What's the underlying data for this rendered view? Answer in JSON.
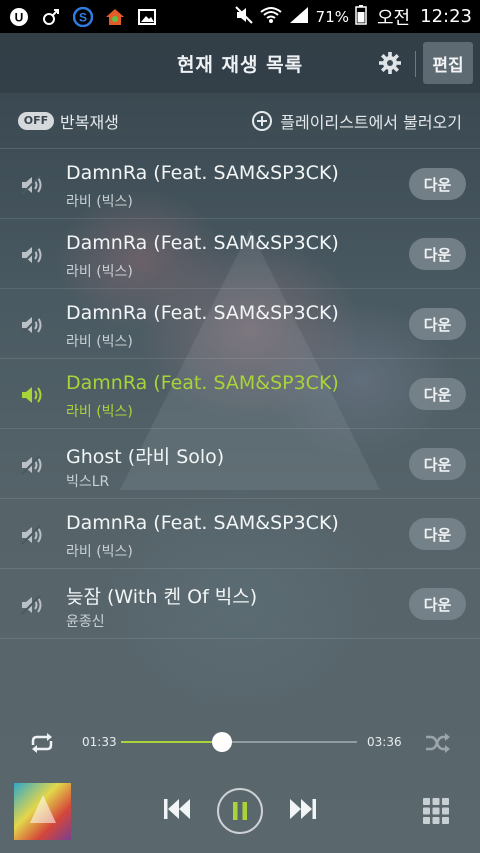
{
  "status_bar": {
    "battery": "71%",
    "ampm": "오전",
    "time": "12:23"
  },
  "header": {
    "title": "현재 재생 목록",
    "edit_label": "편집"
  },
  "toolbar": {
    "repeat_badge": "OFF",
    "repeat_label": "반복재생",
    "load_playlist_label": "플레이리스트에서 불러오기"
  },
  "playlist": [
    {
      "title": "DamnRa (Feat. SAM&SP3CK)",
      "artist": "라비 (빅스)",
      "download": "다운",
      "playing": false
    },
    {
      "title": "DamnRa (Feat. SAM&SP3CK)",
      "artist": "라비 (빅스)",
      "download": "다운",
      "playing": false
    },
    {
      "title": "DamnRa (Feat. SAM&SP3CK)",
      "artist": "라비 (빅스)",
      "download": "다운",
      "playing": false
    },
    {
      "title": "DamnRa (Feat. SAM&SP3CK)",
      "artist": "라비 (빅스)",
      "download": "다운",
      "playing": true
    },
    {
      "title": "Ghost (라비 Solo)",
      "artist": "빅스LR",
      "download": "다운",
      "playing": false
    },
    {
      "title": "DamnRa (Feat. SAM&SP3CK)",
      "artist": "라비 (빅스)",
      "download": "다운",
      "playing": false
    },
    {
      "title": "늦잠 (With 켄 Of 빅스)",
      "artist": "윤종신",
      "download": "다운",
      "playing": false
    }
  ],
  "progress": {
    "current": "01:33",
    "total": "03:36",
    "fraction": 0.43
  },
  "colors": {
    "accent": "#a8d43a",
    "row_button": "#78848c",
    "header": "#323e46"
  },
  "icons": {
    "row_idle": "sound-off-icon",
    "row_playing": "speaker-playing-icon",
    "repeat": "repeat-icon",
    "shuffle": "shuffle-icon",
    "prev": "previous-track-icon",
    "pause": "pause-icon",
    "next": "next-track-icon",
    "grid": "grid-menu-icon",
    "settings": "gear-icon"
  }
}
